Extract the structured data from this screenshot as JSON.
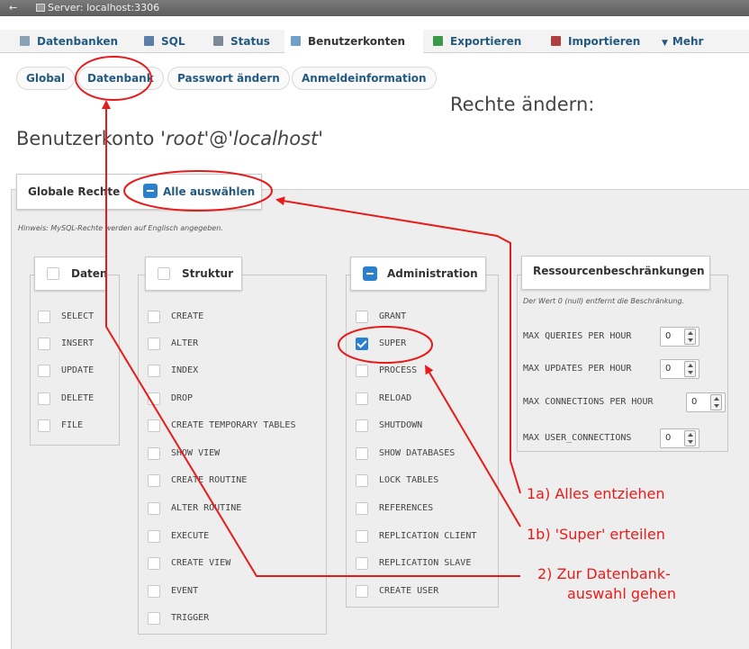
{
  "window": {
    "back_glyph": "←",
    "server_label": "Server: localhost:3306"
  },
  "topnav": {
    "tabs": [
      {
        "label": "Datenbanken",
        "icon": "database-icon"
      },
      {
        "label": "SQL",
        "icon": "sql-icon"
      },
      {
        "label": "Status",
        "icon": "status-icon"
      },
      {
        "label": "Benutzerkonten",
        "icon": "users-icon",
        "active": true
      },
      {
        "label": "Exportieren",
        "icon": "export-icon"
      },
      {
        "label": "Importieren",
        "icon": "import-icon"
      },
      {
        "label": "Mehr",
        "icon": "chevron-down-icon"
      }
    ],
    "more_glyph": "▼"
  },
  "subtabs": [
    "Global",
    "Datenbank",
    "Passwort ändern",
    "Anmeldeinformation"
  ],
  "page": {
    "title_right": "Rechte ändern:",
    "account_prefix": "Benutzerkonto '",
    "account_user": "root",
    "account_mid": "'@'",
    "account_host": "localhost",
    "account_suffix": "'"
  },
  "global_privileges": {
    "legend": "Globale Rechte",
    "select_all": "Alle auswählen",
    "hint": "Hinweis: MySQL-Rechte werden auf Englisch angegeben.",
    "groups": {
      "daten": {
        "title": "Daten",
        "items": [
          "SELECT",
          "INSERT",
          "UPDATE",
          "DELETE",
          "FILE"
        ]
      },
      "struktur": {
        "title": "Struktur",
        "items": [
          "CREATE",
          "ALTER",
          "INDEX",
          "DROP",
          "CREATE TEMPORARY TABLES",
          "SHOW VIEW",
          "CREATE ROUTINE",
          "ALTER ROUTINE",
          "EXECUTE",
          "CREATE VIEW",
          "EVENT",
          "TRIGGER"
        ]
      },
      "administration": {
        "title": "Administration",
        "items": [
          "GRANT",
          "SUPER",
          "PROCESS",
          "RELOAD",
          "SHUTDOWN",
          "SHOW DATABASES",
          "LOCK TABLES",
          "REFERENCES",
          "REPLICATION CLIENT",
          "REPLICATION SLAVE",
          "CREATE USER"
        ],
        "checked": [
          "SUPER"
        ]
      }
    }
  },
  "resource_limits": {
    "title": "Ressourcenbeschränkungen",
    "note": "Der Wert 0 (null) entfernt die Beschränkung.",
    "rows": [
      {
        "label": "MAX QUERIES PER HOUR",
        "value": "0"
      },
      {
        "label": "MAX UPDATES PER HOUR",
        "value": "0"
      },
      {
        "label": "MAX CONNECTIONS PER HOUR",
        "value": "0"
      },
      {
        "label": "MAX USER_CONNECTIONS",
        "value": "0"
      }
    ]
  },
  "annotations": {
    "color": "#e81b1b",
    "a1": "1a) Alles entziehen",
    "a2": "1b) 'Super' erteilen",
    "a3_line1": "2) Zur Datenbank-",
    "a3_line2": "auswahl gehen"
  }
}
